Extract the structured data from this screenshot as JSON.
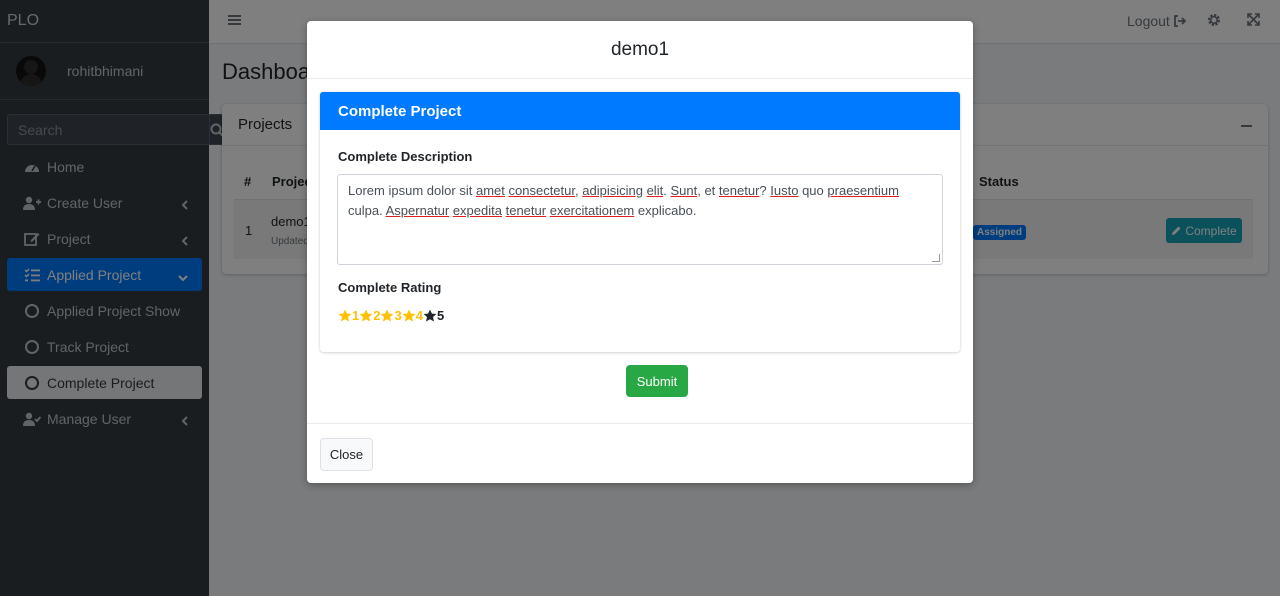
{
  "app": {
    "brand": "PLO"
  },
  "user": {
    "name": "rohitbhimani"
  },
  "search": {
    "placeholder": "Search"
  },
  "sidebar": {
    "items": [
      {
        "label": "Home",
        "icon": "dashboard-icon"
      },
      {
        "label": "Create User",
        "icon": "user-plus-icon"
      },
      {
        "label": "Project",
        "icon": "edit-icon"
      },
      {
        "label": "Applied Project",
        "icon": "list-check-icon"
      },
      {
        "label": "Applied Project Show",
        "icon": "circle-icon"
      },
      {
        "label": "Track Project",
        "icon": "circle-icon"
      },
      {
        "label": "Complete Project",
        "icon": "circle-icon"
      },
      {
        "label": "Manage User",
        "icon": "user-check-icon"
      }
    ]
  },
  "topbar": {
    "logout_label": "Logout"
  },
  "page": {
    "title": "Dashboard"
  },
  "projects_card": {
    "title": "Projects",
    "columns": [
      "#",
      "Project",
      "Status"
    ],
    "rows": [
      {
        "num": "1",
        "name": "demo1",
        "updated": "Updated",
        "status": "Assigned",
        "action": "Complete"
      }
    ]
  },
  "modal": {
    "title": "demo1",
    "card_title": "Complete Project",
    "description_label": "Complete Description",
    "description_text": "Lorem ipsum dolor sit amet consectetur, adipisicing elit. Sunt, et tenetur? Iusto quo praesentium culpa. Aspernatur expedita tenetur exercitationem explicabo.",
    "rating_label": "Complete Rating",
    "rating": {
      "options": [
        "1",
        "2",
        "3",
        "4",
        "5"
      ],
      "selected": 4,
      "max": 5
    },
    "submit_label": "Submit",
    "close_label": "Close"
  },
  "colors": {
    "primary": "#007bff",
    "success": "#28a745",
    "info": "#17a2b8",
    "star": "#ffc107",
    "sidebar_bg": "#343a40"
  }
}
